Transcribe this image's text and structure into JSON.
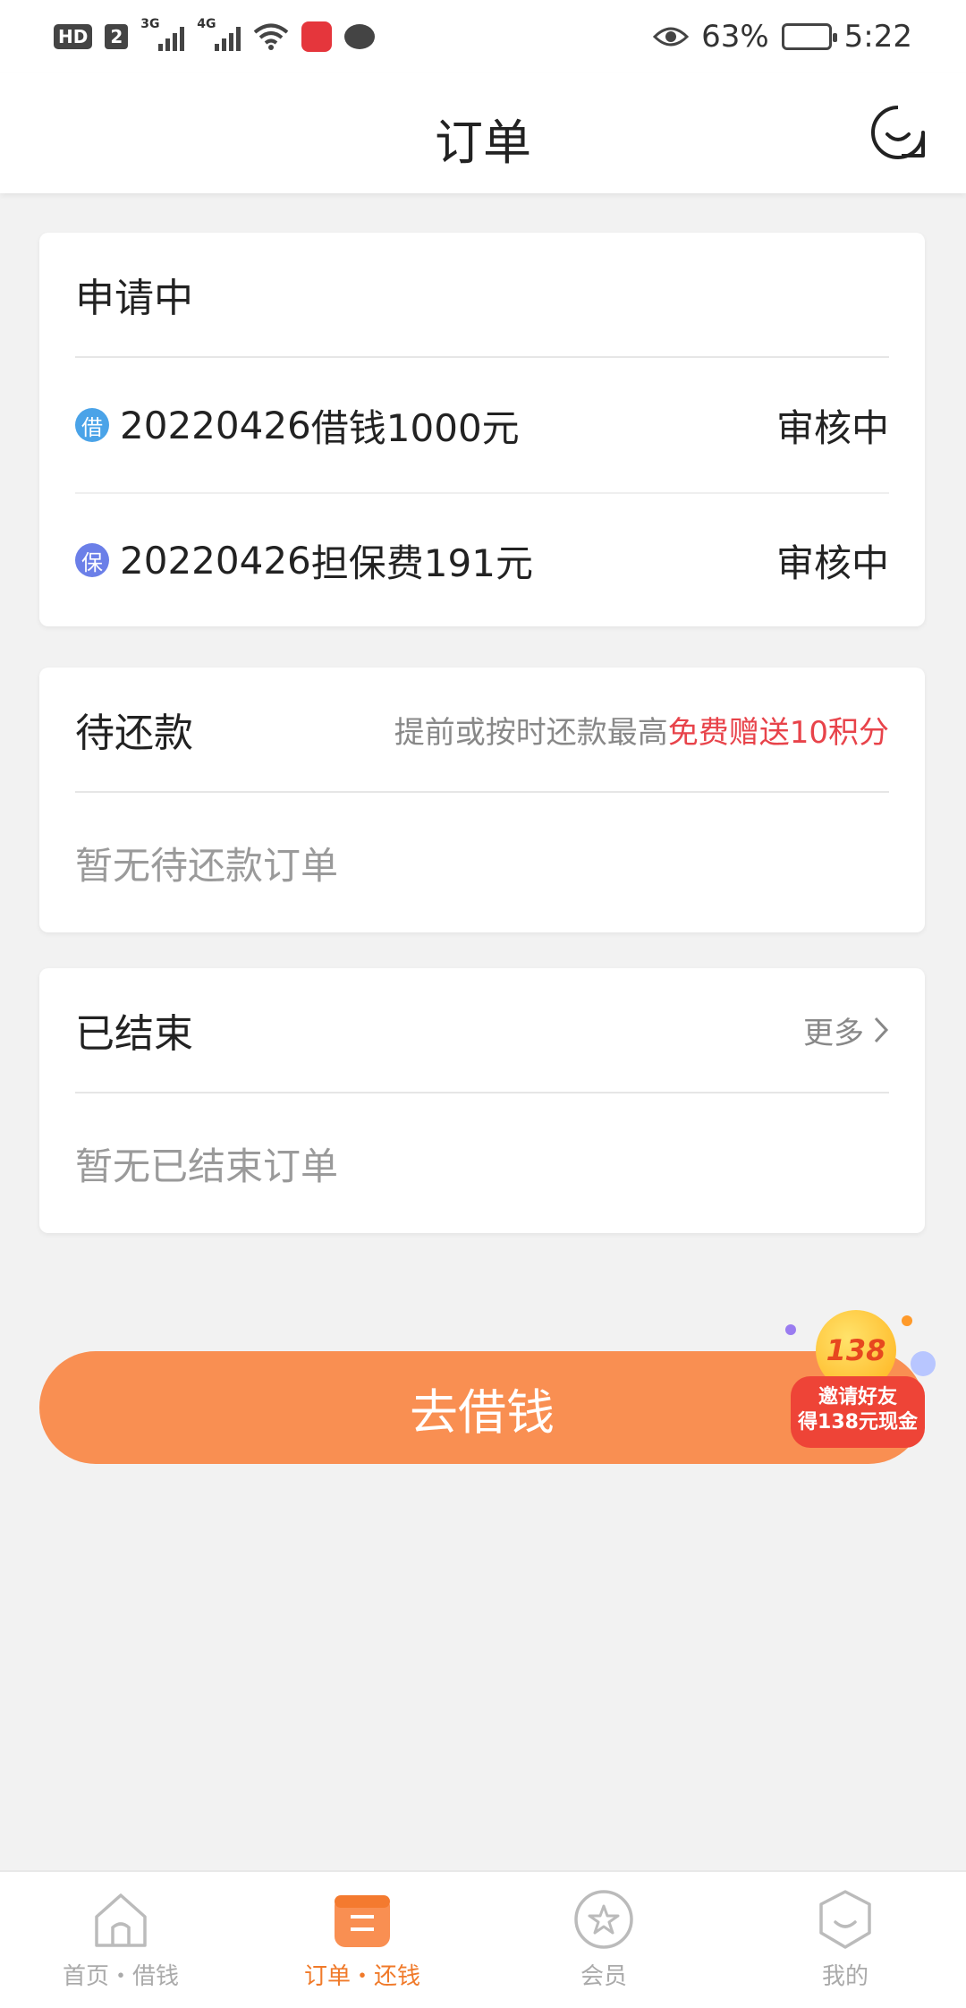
{
  "status_bar": {
    "hd": "HD",
    "sim": "2",
    "net1": "3G",
    "net2": "4G",
    "battery_percent": "63%",
    "battery_level": 0.63,
    "time": "5:22"
  },
  "header": {
    "title": "订单"
  },
  "applying": {
    "title": "申请中",
    "rows": [
      {
        "badge": "借",
        "badge_color": "#4aa3e8",
        "date": "20220426",
        "desc": "借钱1000元",
        "status": "审核中"
      },
      {
        "badge": "保",
        "badge_color": "#6b7fe8",
        "date": "20220426",
        "desc": "担保费191元",
        "status": "审核中"
      }
    ]
  },
  "pending": {
    "title": "待还款",
    "hint_plain": "提前或按时还款最高",
    "hint_highlight": "免费赠送10积分",
    "empty": "暂无待还款订单"
  },
  "finished": {
    "title": "已结束",
    "more": "更多",
    "empty": "暂无已结束订单"
  },
  "cta": {
    "label": "去借钱"
  },
  "promo": {
    "number": "138",
    "line1": "邀请好友",
    "line2": "得138元现金"
  },
  "nav": [
    {
      "label": "首页・借钱",
      "icon": "home-icon",
      "active": false
    },
    {
      "label": "订单・还钱",
      "icon": "orders-icon",
      "active": true
    },
    {
      "label": "会员",
      "icon": "star-icon",
      "active": false
    },
    {
      "label": "我的",
      "icon": "profile-icon",
      "active": false
    }
  ],
  "colors": {
    "accent": "#f98f52",
    "active_nav": "#f07a2a",
    "highlight": "#e8434a"
  }
}
